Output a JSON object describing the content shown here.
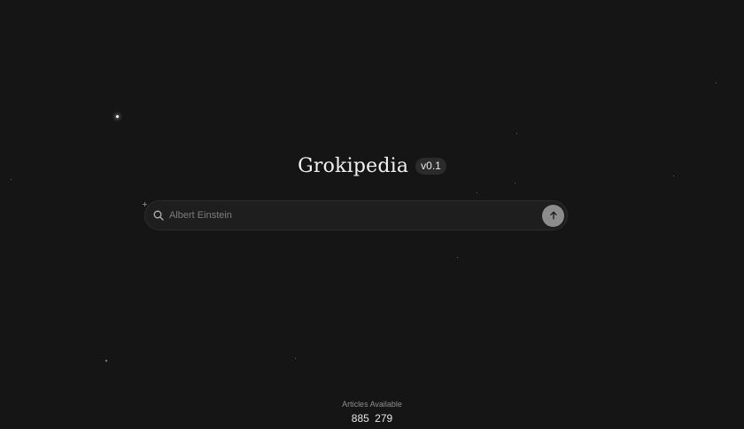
{
  "brand": {
    "title": "Grokipedia",
    "version": "v0.1"
  },
  "search": {
    "placeholder": "Albert Einstein",
    "value": "",
    "search_icon": "search-icon",
    "submit_icon": "arrow-up-icon"
  },
  "stats": {
    "label": "Articles Available",
    "count": "885 279"
  },
  "colors": {
    "background": "#151515",
    "search_background": "#1e1e1e",
    "submit_button": "#8c8c8c",
    "text": "#f2f2f2",
    "muted_text": "#8e8e8e"
  }
}
